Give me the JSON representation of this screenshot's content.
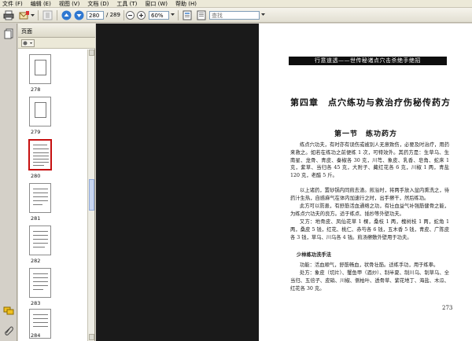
{
  "menu": [
    "文件 (F)",
    "编辑 (E)",
    "视图 (V)",
    "文档 (D)",
    "工具 (T)",
    "窗口 (W)",
    "帮助 (H)"
  ],
  "toolbar": {
    "page_current": "280",
    "page_total": "/ 289",
    "zoom": "60%",
    "search_placeholder": "查找"
  },
  "nav": {
    "title": "页面",
    "pages": [
      "278",
      "279",
      "280",
      "281",
      "282",
      "283",
      "284"
    ],
    "selected": "280"
  },
  "document": {
    "header": "行意道透——世传秘诸点穴击杀绝手绝招",
    "chapter_title": "第四章　点穴练功与救治疗伤秘传药方",
    "section_title": "第一节　练功药方",
    "paragraph1": "练点穴功夫，有时亦有误伤或被别人无意致伤，必要及时治疗，用药来救之。如若在练功之前便练 1 次，可特效外。其药方是：生草乌、生南星、龙骨、青皮、秦椒各 30 克，川芎、象皮、乳香、皂角、蛇床 1 克，紫草、当归各 45 克，大附子、藏红花各 6 克，川椒 1 两，青盐 120 克，老醋 5 斤。",
    "paragraph2": "以上诸药，置砂锅内同煎去渣。煎溢时，将两手放入盆内熏洗之，待药汁生热，自感麻气在体内加速行之时，出手擦干，然后练功。",
    "paragraph3": "此方可以防患，有舒筋活血通络之功，有壮血益气补强筋健骨之能，为练点穴功夫的良方。适于练点、插抄等外壁功夫。",
    "paragraph4": "又方：地骨皮、凤仙花草 1 棵，桑枝 1 两，槐树枝 1 两，蛇角 1 两，桑皮 5 钱，红花、桃仁、赤芍各 6 钱，五木香 5 钱，青皮、广陈皮各 3 钱，草乌、川乌各 4 钱。煎汤擦敷外壁用于功夫。",
    "sub_title": "少林练功洗手法",
    "paragraph5": "功能：活血顺气，舒筋畅血，状骨壮筋。适练手功，用于练拳。",
    "paragraph6": "处方：象皮（切片）、蟹鱼甲（酒炒）、制半夏、制川乌、制草乌、全当归、五倍子、皮硝、川椒、侧柏叶、透骨草、紫花地丁、海盐、木瓜、红花各 30 克。",
    "page_number": "273"
  }
}
